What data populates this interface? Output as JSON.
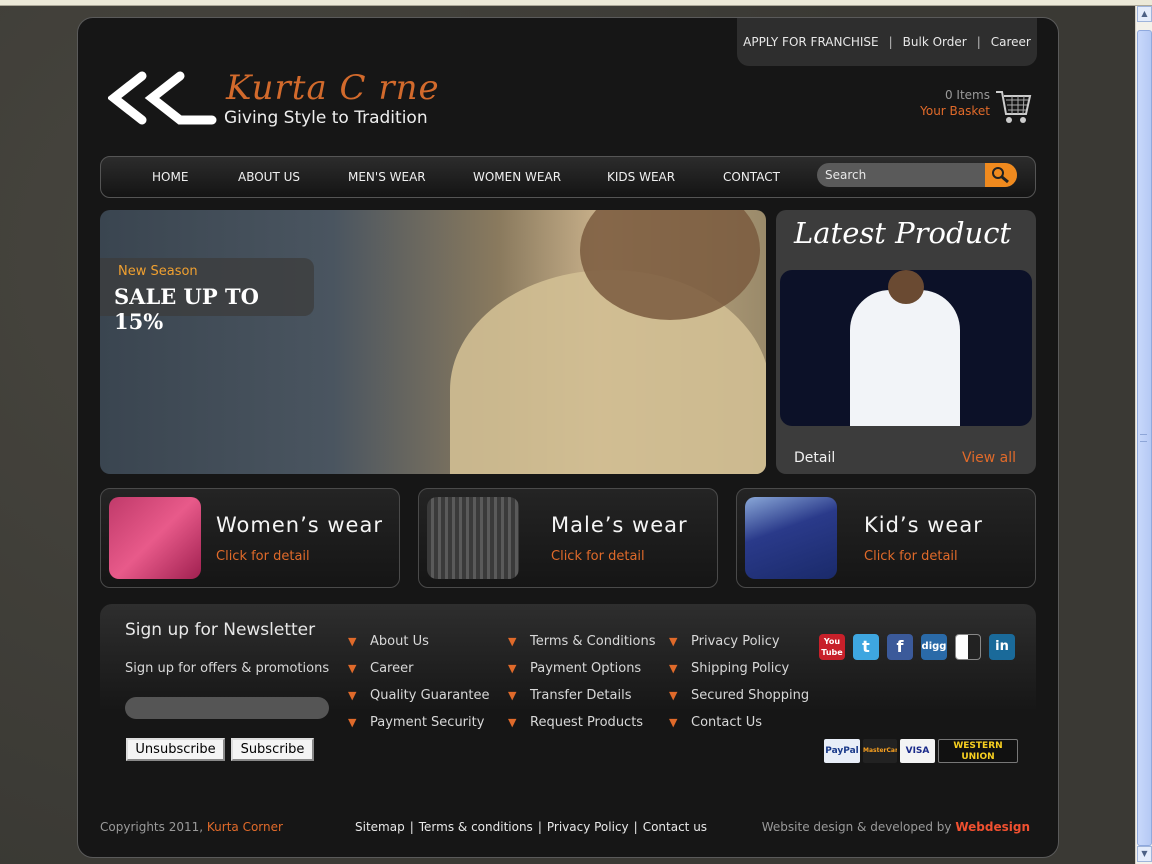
{
  "toplinks": {
    "franchise": "APPLY FOR FRANCHISE",
    "sep": "|",
    "bulk": "Bulk Order",
    "career": "Career"
  },
  "logo": {
    "brand": "Kurta C rne",
    "tagline": "Giving Style to Tradition"
  },
  "basket": {
    "items": "0 Items",
    "label": "Your Basket"
  },
  "nav": {
    "items": [
      "HOME",
      "ABOUT US",
      "MEN'S WEAR",
      "WOMEN WEAR",
      "KIDS WEAR",
      "CONTACT"
    ],
    "search_placeholder": "Search"
  },
  "hero": {
    "season": "New Season",
    "sale": "SALE UP TO 15%"
  },
  "latest": {
    "title": "Latest Product",
    "detail": "Detail",
    "view_all": "View all"
  },
  "categories": [
    {
      "name": "Women’s wear",
      "click": "Click for detail"
    },
    {
      "name": "Male’s wear",
      "click": "Click for detail"
    },
    {
      "name": "Kid’s wear",
      "click": "Click for detail"
    }
  ],
  "newsletter": {
    "title": "Sign up for Newsletter",
    "subtitle": "Sign up for offers & promotions",
    "unsubscribe": "Unsubscribe",
    "subscribe": "Subscribe"
  },
  "footer_links": [
    [
      "About Us",
      "Career",
      "Quality Guarantee",
      "Payment Security"
    ],
    [
      "Terms & Conditions",
      "Payment Options",
      "Transfer Details",
      "Request Products"
    ],
    [
      "Privacy Policy",
      "Shipping Policy",
      "Secured Shopping",
      "Contact Us"
    ]
  ],
  "social": [
    {
      "icon": "youtube-icon",
      "label": "You Tube",
      "color": "#c8202a"
    },
    {
      "icon": "twitter-icon",
      "label": "t",
      "color": "#3ea6e0"
    },
    {
      "icon": "facebook-icon",
      "label": "f",
      "color": "#3b5a9a"
    },
    {
      "icon": "digg-icon",
      "label": "digg",
      "color": "#2a6aa8"
    },
    {
      "icon": "delicious-icon",
      "label": "",
      "color": "#dddddd"
    },
    {
      "icon": "linkedin-icon",
      "label": "in",
      "color": "#1a6a9a"
    }
  ],
  "payments": [
    "PayPal",
    "MasterCard",
    "VISA",
    "WESTERN UNION"
  ],
  "bottom": {
    "copyright": "Copyrights 2011,",
    "brand": "Kurta Corner",
    "links": [
      "Sitemap",
      "Terms & conditions",
      "Privacy Policy",
      "Contact us"
    ],
    "sep": "|",
    "design_text": "Website design & developed by",
    "design_brand": "Webdesign"
  },
  "colors": {
    "accent": "#e06a2a",
    "search_button": "#f08a1e",
    "background": "#161616"
  }
}
